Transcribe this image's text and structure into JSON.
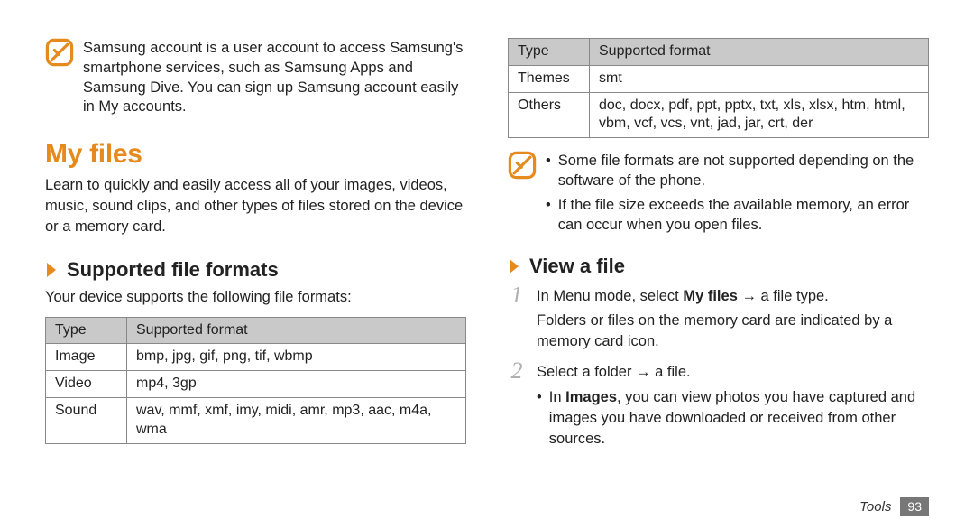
{
  "left": {
    "note": "Samsung account is a user account to access Samsung's smartphone services, such as Samsung Apps and Samsung Dive. You can sign up Samsung account easily in My accounts.",
    "h1": "My files",
    "intro": "Learn to quickly and easily access all of your images, videos, music, sound clips, and other types of files stored on the device or a memory card.",
    "h2": "Supported file formats",
    "subtext": "Your device supports the following file formats:",
    "table": {
      "head": {
        "c1": "Type",
        "c2": "Supported format"
      },
      "rows": [
        {
          "c1": "Image",
          "c2": "bmp, jpg, gif, png, tif, wbmp"
        },
        {
          "c1": "Video",
          "c2": "mp4, 3gp"
        },
        {
          "c1": "Sound",
          "c2": "wav, mmf, xmf, imy, midi, amr, mp3, aac, m4a, wma"
        }
      ]
    }
  },
  "right": {
    "table": {
      "head": {
        "c1": "Type",
        "c2": "Supported format"
      },
      "rows": [
        {
          "c1": "Themes",
          "c2": "smt"
        },
        {
          "c1": "Others",
          "c2": "doc, docx, pdf, ppt, pptx, txt, xls, xlsx, htm, html, vbm, vcf, vcs, vnt, jad, jar, crt, der"
        }
      ]
    },
    "note_items": [
      "Some file formats are not supported depending on the software of the phone.",
      "If the file size exceeds the available memory, an error can occur when you open files."
    ],
    "h2": "View a file",
    "steps": {
      "s1_num": "1",
      "s1_pre": "In Menu mode, select ",
      "s1_bold": "My files",
      "s1_post": " → a file type.",
      "s1_extra": "Folders or files on the memory card are indicated by a memory card icon.",
      "s2_num": "2",
      "s2_text": "Select a folder → a file.",
      "s2_sub_pre": "In ",
      "s2_sub_bold": "Images",
      "s2_sub_post": ", you can view photos you have captured and images you have downloaded or received from other sources."
    }
  },
  "footer": {
    "section": "Tools",
    "page": "93"
  },
  "chart_data": [
    {
      "type": "table",
      "title": "Supported file formats (part 1)",
      "columns": [
        "Type",
        "Supported format"
      ],
      "rows": [
        [
          "Image",
          "bmp, jpg, gif, png, tif, wbmp"
        ],
        [
          "Video",
          "mp4, 3gp"
        ],
        [
          "Sound",
          "wav, mmf, xmf, imy, midi, amr, mp3, aac, m4a, wma"
        ]
      ]
    },
    {
      "type": "table",
      "title": "Supported file formats (part 2)",
      "columns": [
        "Type",
        "Supported format"
      ],
      "rows": [
        [
          "Themes",
          "smt"
        ],
        [
          "Others",
          "doc, docx, pdf, ppt, pptx, txt, xls, xlsx, htm, html, vbm, vcf, vcs, vnt, jad, jar, crt, der"
        ]
      ]
    }
  ]
}
